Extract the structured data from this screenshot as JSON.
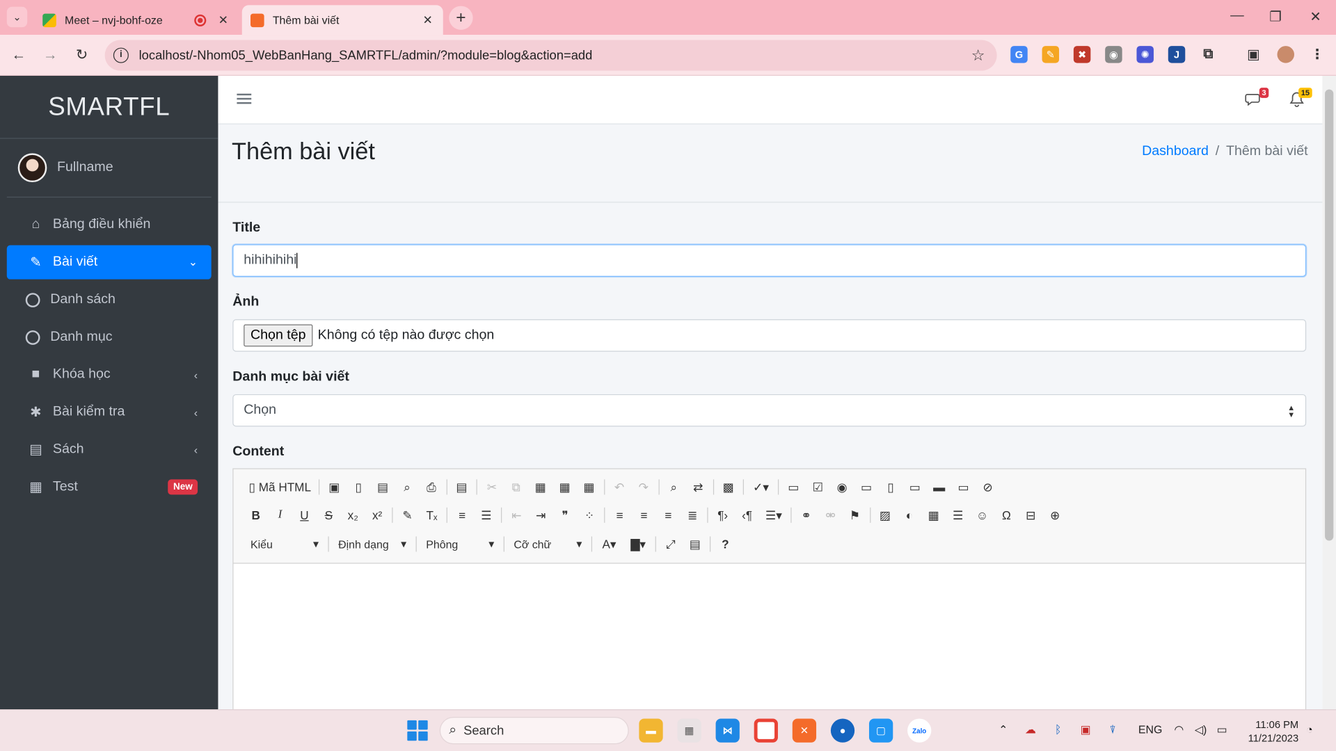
{
  "browser": {
    "tabs": [
      {
        "title": "Meet – nvj-bohf-oze",
        "active": false,
        "recording": true
      },
      {
        "title": "Thêm bài viết",
        "active": true,
        "recording": false
      }
    ],
    "url": "localhost/-Nhom05_WebBanHang_SAMRTFL/admin/?module=blog&action=add",
    "accent": "#f8b4c0"
  },
  "sidebar": {
    "brand": "SMARTFL",
    "user": "Fullname",
    "items": [
      {
        "label": "Bảng điều khiển",
        "icon": "home-icon"
      },
      {
        "label": "Bài viết",
        "icon": "blog-icon",
        "active": true
      },
      {
        "label": "Danh sách",
        "icon": "circle-icon",
        "sub": true
      },
      {
        "label": "Danh mục",
        "icon": "circle-icon",
        "sub": true
      },
      {
        "label": "Khóa học",
        "icon": "video-icon"
      },
      {
        "label": "Bài kiểm tra",
        "icon": "bug-icon"
      },
      {
        "label": "Sách",
        "icon": "book-icon"
      },
      {
        "label": "Test",
        "icon": "grid-icon",
        "badge": "New"
      }
    ]
  },
  "topnav": {
    "messages_count": "3",
    "notifications_count": "15"
  },
  "header": {
    "title": "Thêm bài viết",
    "breadcrumb_home": "Dashboard",
    "breadcrumb_current": "Thêm bài viết"
  },
  "form": {
    "title_label": "Title",
    "title_value": "hihihihihi",
    "image_label": "Ảnh",
    "file_button": "Chọn tệp",
    "file_status": "Không có tệp nào được chọn",
    "category_label": "Danh mục bài viết",
    "category_selected": "Chọn",
    "content_label": "Content"
  },
  "editor": {
    "source_label": "Mã HTML",
    "style_combo": "Kiểu",
    "format_combo": "Định dạng",
    "font_combo": "Phông",
    "size_combo": "Cỡ chữ",
    "help": "?"
  },
  "taskbar": {
    "search_placeholder": "Search",
    "lang": "ENG",
    "time": "11:06 PM",
    "date": "11/21/2023"
  }
}
